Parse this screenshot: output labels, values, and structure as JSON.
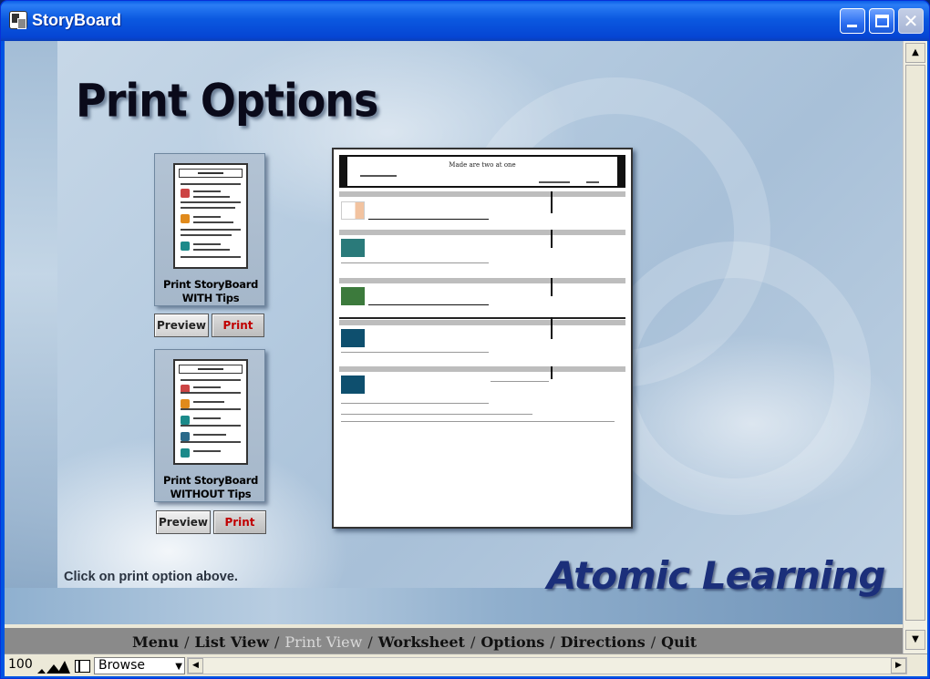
{
  "window": {
    "title": "StoryBoard",
    "close_glyph": "✕"
  },
  "main": {
    "heading": "Print Options",
    "options": [
      {
        "label": "Print StoryBoard WITH Tips",
        "preview_label": "Preview",
        "print_label": "Print"
      },
      {
        "label": "Print StoryBoard WITHOUT Tips",
        "preview_label": "Preview",
        "print_label": "Print"
      }
    ],
    "preview_sheet": {
      "title": "Made are two at one"
    },
    "hint": "Click on print option above.",
    "logo_text": "Atomic Learning"
  },
  "nav": {
    "items": [
      {
        "label": "Menu"
      },
      {
        "label": "List View"
      },
      {
        "label": "Print View",
        "active": true
      },
      {
        "label": "Worksheet"
      },
      {
        "label": "Options"
      },
      {
        "label": "Directions"
      },
      {
        "label": "Quit"
      }
    ],
    "separator": "/"
  },
  "status": {
    "zoom": "100",
    "mode": "Browse"
  },
  "colors": {
    "title_bar": "#0b59e0",
    "print_text": "#c00000",
    "logo": "#1b2f7a",
    "nav_bar": "#8a8a8a"
  }
}
